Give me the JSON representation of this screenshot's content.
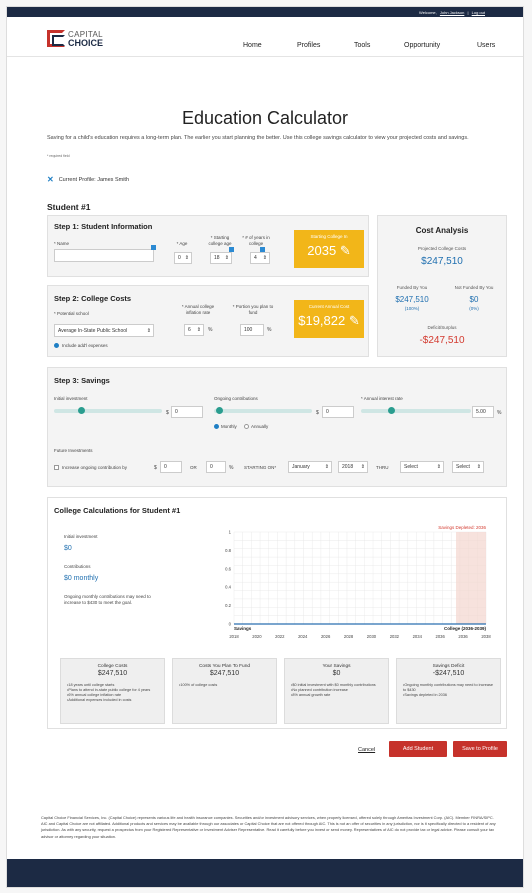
{
  "topbar": {
    "welcome": "Welcome,",
    "user": "John Jackson",
    "sep": "|",
    "logout": "Log out"
  },
  "brand": {
    "line1": "CAPITAL",
    "line2": "CHOICE"
  },
  "nav": [
    "Home",
    "Profiles",
    "Tools",
    "Opportunity",
    "Users"
  ],
  "page": {
    "title": "Education Calculator",
    "intro": "Saving for a child's education requires a long-term plan. The earlier you start planning the better. Use this college savings calculator to view your projected costs and savings.",
    "required_note": "* required field",
    "current_profile": "Current Profile: James Smith",
    "student_heading": "Student #1"
  },
  "step1": {
    "title": "Step 1: Student Information",
    "name_label": "* Name",
    "name_value": "",
    "age_label": "* Age",
    "age_value": "0",
    "starting_age_label": "* Starting college age",
    "starting_age_value": "18",
    "years_label": "* # of years in college",
    "years_value": "4",
    "starting_college_label": "Starting College In",
    "starting_college_value": "2035"
  },
  "step2": {
    "title": "Step 2: College Costs",
    "school_label": "* Potential school",
    "school_value": "Average In-State Public School",
    "inflation_label": "* Annual college inflation rate",
    "inflation_value": "6",
    "portion_label": "* Portion you plan to fund",
    "portion_value": "100",
    "percent": "%",
    "include_label": "Include add'l expenses",
    "current_cost_label": "Current Annual Cost",
    "current_cost_value": "$19,822"
  },
  "cost_analysis": {
    "title": "Cost Analysis",
    "projected_label": "Projected College Costs",
    "projected_value": "$247,510",
    "funded_label": "Funded By You",
    "funded_value": "$247,510",
    "funded_pct": "(100%)",
    "not_funded_label": "Not Funded By You",
    "not_funded_value": "$0",
    "not_funded_pct": "(0%)",
    "deficit_label": "Deficit/Surplus",
    "deficit_value": "-$247,510"
  },
  "step3": {
    "title": "Step 3: Savings",
    "initial_label": "Initial investment",
    "initial_value": "0",
    "ongoing_label": "Ongoing contributions",
    "ongoing_value": "0",
    "interest_label": "* Annual interest rate",
    "interest_value": "5.00",
    "dollar": "$",
    "percent": "%",
    "monthly": "Monthly",
    "annually": "Annually",
    "future_label": "Future Investments",
    "increase_label": "Increase ongoing contribution by",
    "increase_value": "0",
    "or": "OR",
    "increase_pct": "0",
    "starting_on": "STARTING ON*",
    "month": "January",
    "year": "2018",
    "thru": "THRU",
    "thru_select1": "Select",
    "thru_select2": "Select"
  },
  "calc": {
    "title": "College Calculations for Student #1",
    "initial_label": "Initial investment",
    "initial_value": "$0",
    "contrib_label": "Contributions",
    "contrib_value": "$0 monthly",
    "note": "Ongoing monthly contributions may need to increase to $430 to meet the goal."
  },
  "chart_data": {
    "type": "line",
    "series": [
      {
        "name": "Savings",
        "values": [
          0,
          0,
          0,
          0,
          0,
          0,
          0,
          0,
          0,
          0,
          0,
          0
        ]
      }
    ],
    "x": [
      2018,
      2020,
      2022,
      2024,
      2026,
      2028,
      2030,
      2032,
      2034,
      2036,
      2036,
      2038
    ],
    "x_tick_labels": [
      "2018",
      "2020",
      "2022",
      "2024",
      "2026",
      "2028",
      "2030",
      "2032",
      "2034",
      "2036",
      "2036",
      "2038"
    ],
    "y_ticks": [
      "0",
      "0.2",
      "0.4",
      "0.6",
      "0.8",
      "1"
    ],
    "ylim": [
      0,
      1
    ],
    "annotation": "Savings Depleted: 2036",
    "region_label": "College (2036-2039)",
    "grid": true
  },
  "cards": [
    {
      "title": "College Costs",
      "value": "$247,510",
      "bullets": [
        "18 years until college starts",
        "Plans to attend in-state public college for 4 years",
        "6% annual college inflation rate",
        "Additional expenses included in costs"
      ]
    },
    {
      "title": "Costs You Plan To Fund",
      "value": "$247,510",
      "bullets": [
        "100% of college costs"
      ]
    },
    {
      "title": "Your Savings",
      "value": "$0",
      "bullets": [
        "$0 initial investment with $0 monthly contributions",
        "No planned contribution increase",
        "8% annual growth rate"
      ]
    },
    {
      "title": "Savings Deficit",
      "value": "-$247,510",
      "bullets": [
        "Ongoing monthly contributions may need to increase to $430",
        "Savings depleted in 2036"
      ]
    }
  ],
  "actions": {
    "cancel": "Cancel",
    "add_student": "Add Student",
    "save": "Save to Profile"
  },
  "disclaimer": "Capital Choice Financial Services, Inc. (Capital Choice) represents various life and health insurance companies. Securities and/or investment advisory services, when properly licensed, offered solely through Ameritas Investment Corp. (AIC). Member FINRA/SIPC. AIC and Capital Choice are not affiliated. Additional products and services may be available through our associates or Capital Choice that are not offered through AIC. This is not an offer of securities in any jurisdiction, nor is it specifically directed to a resident of any jurisdiction. As with any security, request a prospectus from your Registered Representative or Investment Adviser Representative. Read it carefully before you invest or send money. Representatives of AIC do not provide tax or legal advice. Please consult your tax advisor or attorney regarding your situation.",
  "colors": {
    "navy": "#1c2a44",
    "red": "#c6322b",
    "yellow": "#f2b619",
    "blue": "#1f6fb0",
    "teal": "#2a9d8f"
  }
}
